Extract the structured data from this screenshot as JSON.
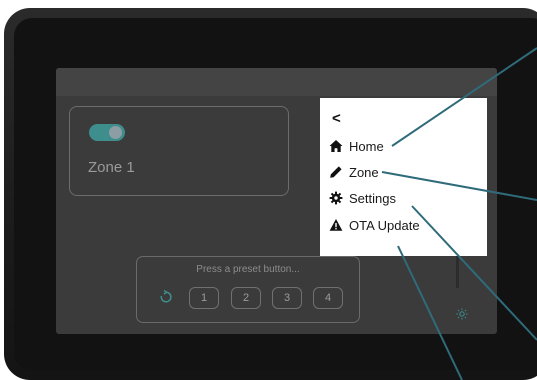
{
  "screen": {
    "zone_card": {
      "label": "Zone 1",
      "toggle_on": true
    },
    "preset_panel": {
      "hint": "Press a preset button...",
      "buttons": [
        "1",
        "2",
        "3",
        "4"
      ]
    }
  },
  "menu": {
    "back_glyph": "<",
    "items": [
      {
        "icon": "home-icon",
        "label": "Home"
      },
      {
        "icon": "pencil-icon",
        "label": "Zone"
      },
      {
        "icon": "gear-icon",
        "label": "Settings"
      },
      {
        "icon": "warning-icon",
        "label": "OTA Update"
      }
    ]
  },
  "colors": {
    "accent": "#3e8e8e",
    "callout": "#2f6b7a",
    "menu_bg": "#ffffff",
    "screen_bg": "#3b3b3b"
  }
}
